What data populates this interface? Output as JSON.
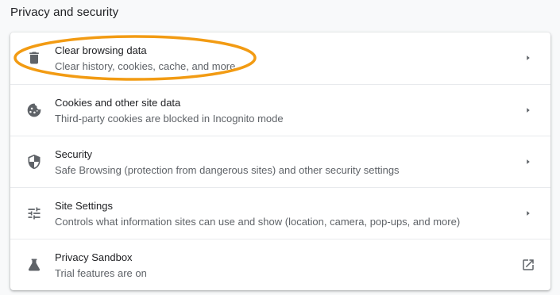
{
  "section": {
    "title": "Privacy and security"
  },
  "items": [
    {
      "title": "Clear browsing data",
      "subtitle": "Clear history, cookies, cache, and more",
      "icon": "trash-icon",
      "action_icon": "arrow-right-icon"
    },
    {
      "title": "Cookies and other site data",
      "subtitle": "Third-party cookies are blocked in Incognito mode",
      "icon": "cookie-icon",
      "action_icon": "arrow-right-icon"
    },
    {
      "title": "Security",
      "subtitle": "Safe Browsing (protection from dangerous sites) and other security settings",
      "icon": "shield-icon",
      "action_icon": "arrow-right-icon"
    },
    {
      "title": "Site Settings",
      "subtitle": "Controls what information sites can use and show (location, camera, pop-ups, and more)",
      "icon": "tune-icon",
      "action_icon": "arrow-right-icon"
    },
    {
      "title": "Privacy Sandbox",
      "subtitle": "Trial features are on",
      "icon": "flask-icon",
      "action_icon": "open-in-new-icon"
    }
  ],
  "colors": {
    "highlight": "#f29b13",
    "icon": "#5f6368",
    "primary_text": "#202124",
    "secondary_text": "#5f6368"
  }
}
